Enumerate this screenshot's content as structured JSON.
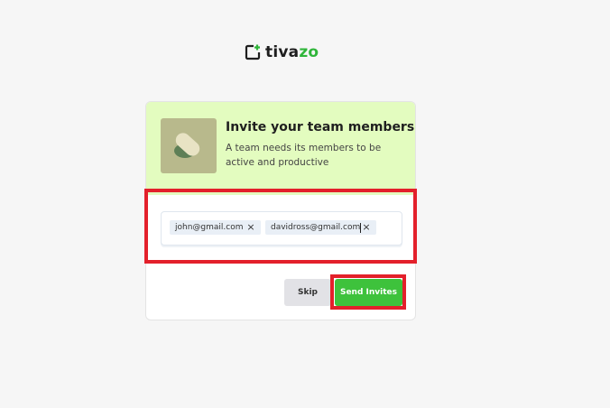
{
  "brand": {
    "name_prefix": "tiva",
    "name_suffix": "zo",
    "icon": "tivazo-logo-icon",
    "accent_color": "#2fb53a"
  },
  "invite": {
    "title": "Invite your team members",
    "subtitle": "A team needs its members to be active and productive",
    "header_color": "#e3fcbf",
    "emails": [
      {
        "value": "john@gmail.com",
        "remove_icon": "close-icon",
        "remove_label": "×"
      },
      {
        "value": "davidross@gmail.com",
        "remove_icon": "close-icon",
        "remove_label": "×"
      }
    ]
  },
  "actions": {
    "skip_label": "Skip",
    "send_label": "Send Invites",
    "send_color": "#3ec23c"
  },
  "annotations": {
    "highlight_color": "#e3202b"
  }
}
